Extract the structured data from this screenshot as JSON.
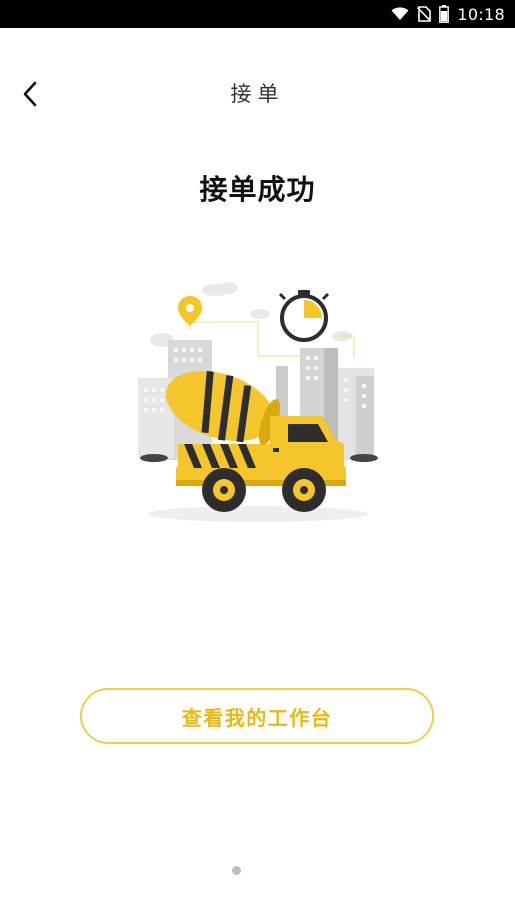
{
  "status_bar": {
    "time": "10:18",
    "icons": [
      "wifi-icon",
      "no-sim-icon",
      "battery-icon"
    ]
  },
  "nav": {
    "back_icon": "chevron-left-icon",
    "title": "接单"
  },
  "main": {
    "success_title": "接单成功",
    "illustration": "cement-mixer-truck-city-illustration",
    "workbench_button_label": "查看我的工作台"
  },
  "colors": {
    "accent_yellow": "#f5c62b",
    "button_border": "#f1cd45",
    "button_text": "#e8b910",
    "truck_dark": "#2d2d2d"
  },
  "pager": {
    "count": 1,
    "active_index": 0
  }
}
